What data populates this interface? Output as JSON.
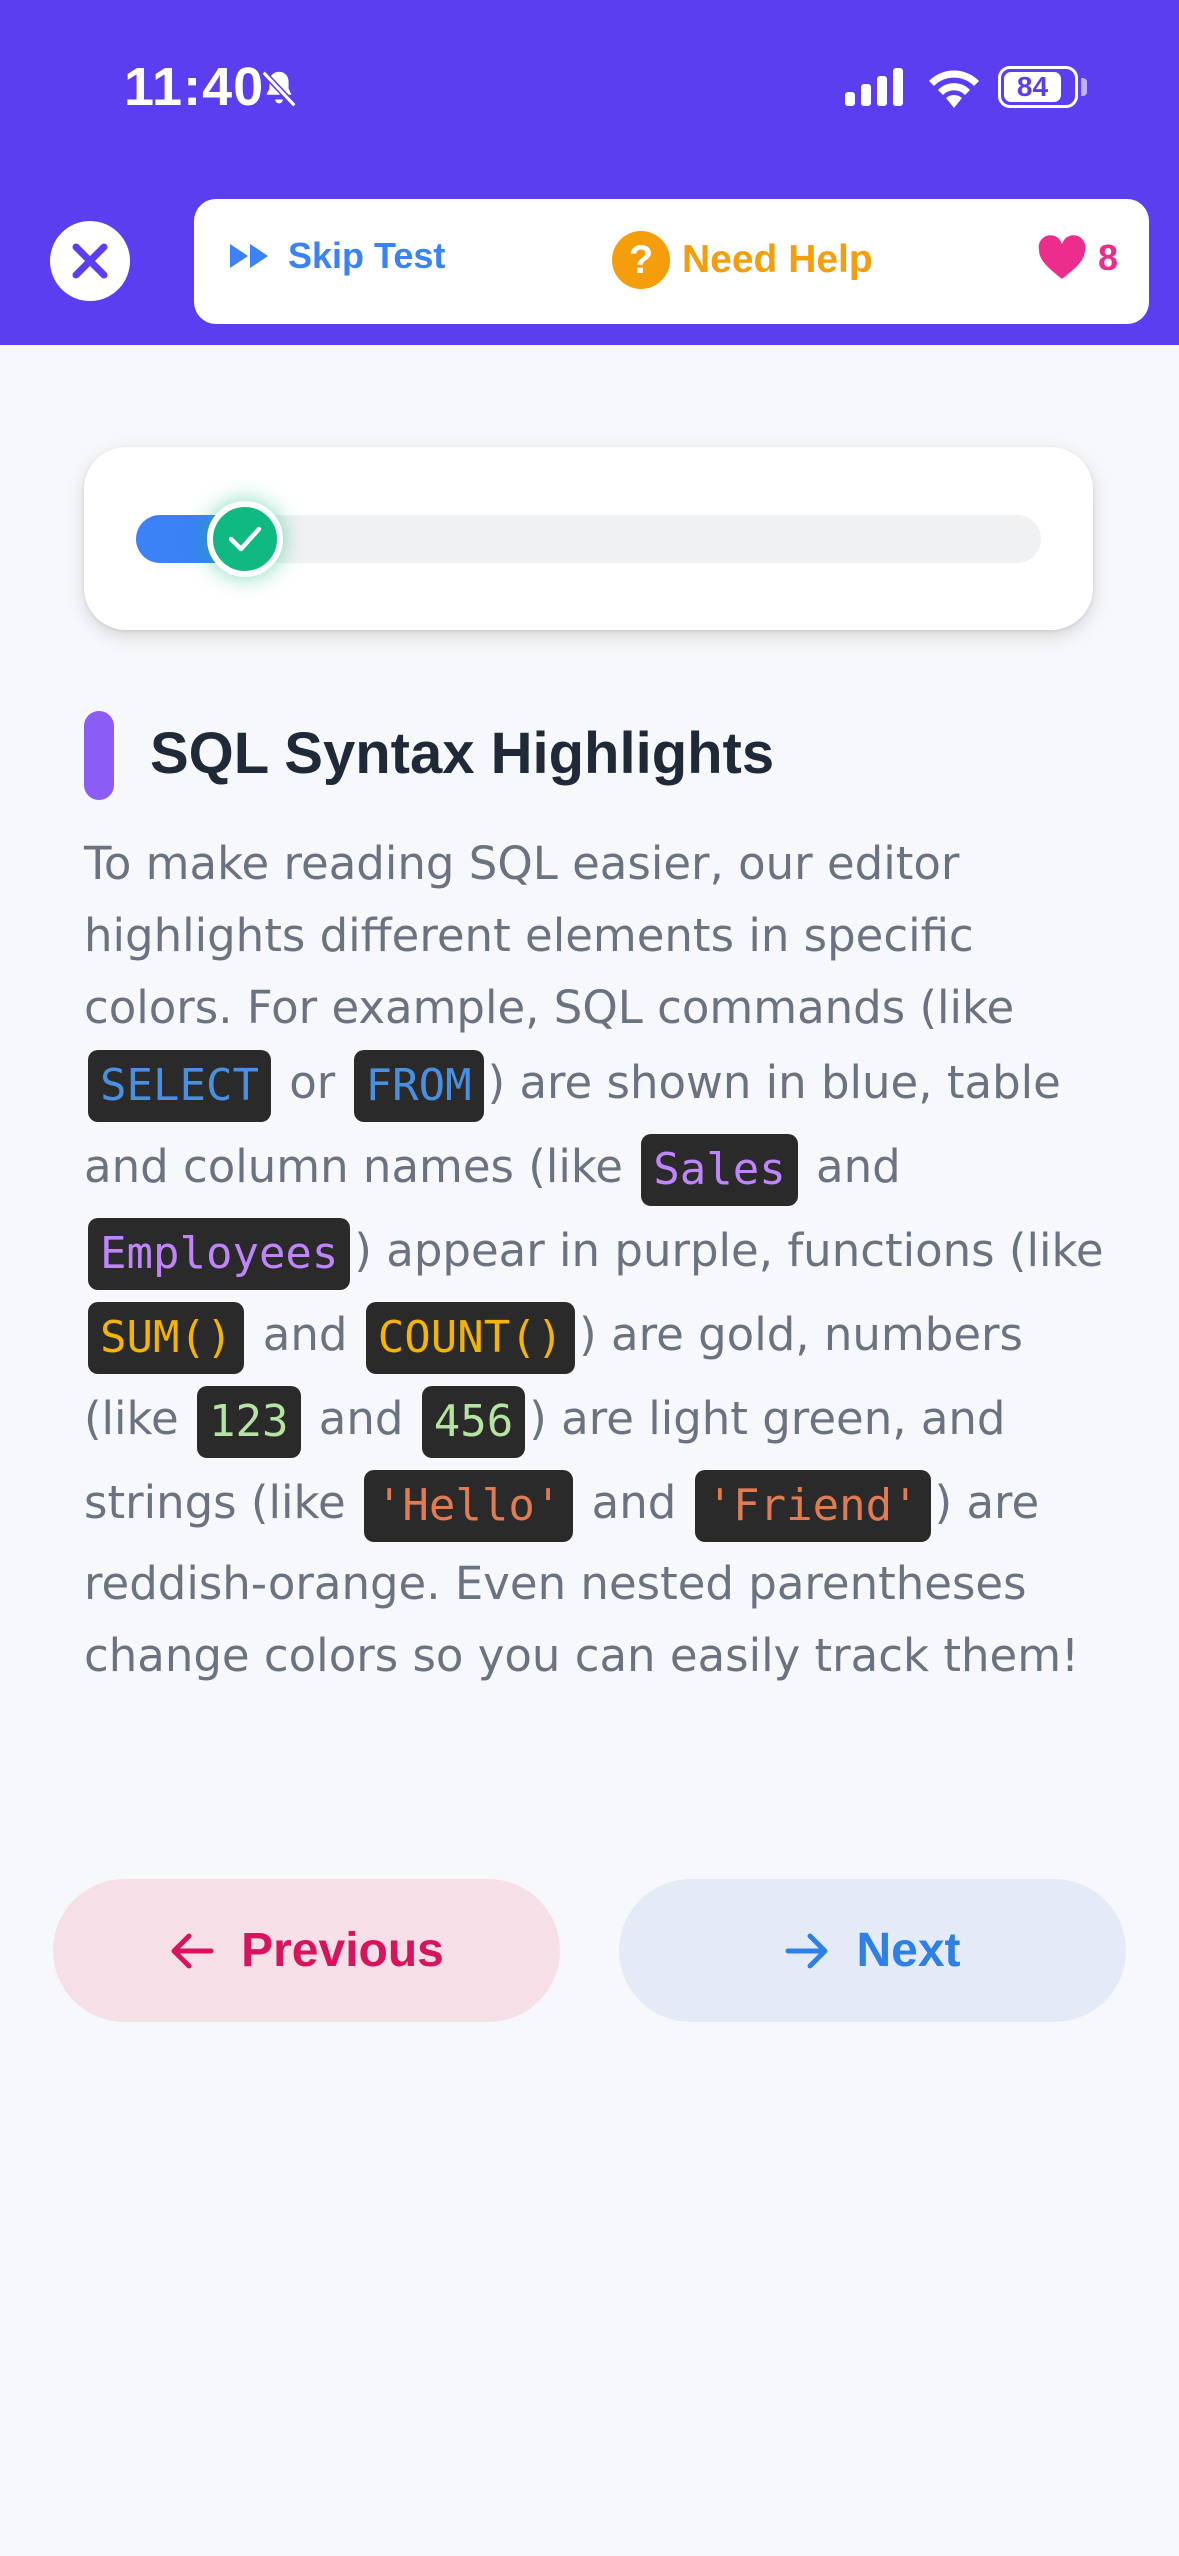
{
  "status_bar": {
    "time": "11:40",
    "battery": "84"
  },
  "toolbar": {
    "skip_label": "Skip Test",
    "help_label": "Need Help",
    "lives": "8"
  },
  "progress": {
    "fraction": 0.12
  },
  "lesson": {
    "title": "SQL Syntax Highlights",
    "t1": "To make reading SQL easier, our editor highlights different elements in specific colors. For example, SQL commands (like ",
    "k_select": "SELECT",
    "t2": " or ",
    "k_from": "FROM",
    "t3": ") are shown in blue, table and column names (like ",
    "k_sales": "Sales",
    "t4": " and ",
    "k_employees": "Employees",
    "t5": ") appear in purple, functions (like ",
    "k_sum": "SUM()",
    "t6": " and ",
    "k_count": "COUNT()",
    "t7": ") are gold, numbers (like ",
    "k_123": "123",
    "t8": " and ",
    "k_456": "456",
    "t9": ") are light green, and strings (like ",
    "k_hello": "'Hello'",
    "t10": " and ",
    "k_friend": "'Friend'",
    "t11": ") are reddish-orange. Even nested parentheses change colors so you can easily track them!"
  },
  "nav": {
    "previous_label": "Previous",
    "next_label": "Next"
  },
  "colors": {
    "header_bg": "#5b3ef0",
    "accent_blue": "#3b82f6",
    "help_orange": "#f59e0b",
    "heart_pink": "#ec2d8c",
    "progress_check": "#10b981",
    "title_bar_purple": "#8b5cf6",
    "prev_text": "#d6155d",
    "next_text": "#2f80e4"
  }
}
